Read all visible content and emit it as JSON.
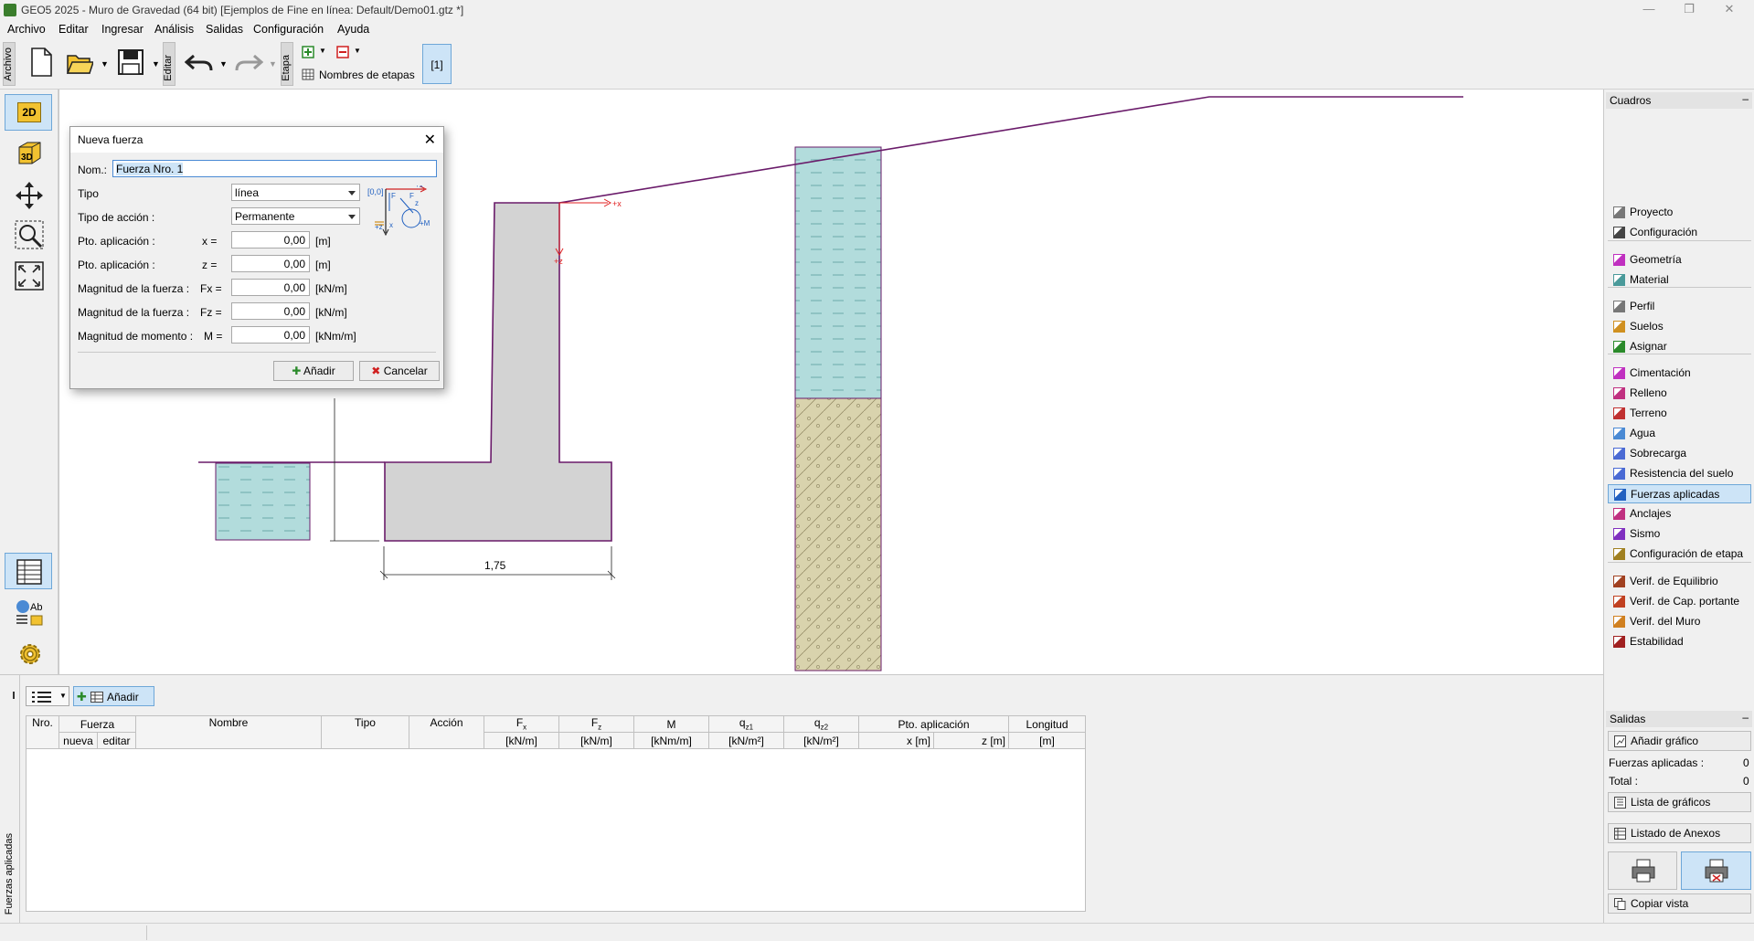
{
  "window": {
    "title": "GEO5 2025 - Muro de Gravedad (64 bit) [Ejemplos de Fine en línea: Default/Demo01.gtz *]"
  },
  "menu": [
    "Archivo",
    "Editar",
    "Ingresar",
    "Análisis",
    "Salidas",
    "Configuración",
    "Ayuda"
  ],
  "toolbar": {
    "archivo_tab": "Archivo",
    "editar_tab": "Editar",
    "etapa_tab": "Etapa",
    "stage_names_label": "Nombres de etapas",
    "stage_button": "[1]"
  },
  "left_tools": {
    "view_2d": "2D",
    "view_3d": "3D",
    "ab_label": "Ab"
  },
  "canvas": {
    "dimension_label": "1,75",
    "axis_x": "+x",
    "axis_z": "+z"
  },
  "dialog": {
    "title": "Nueva fuerza",
    "name_label": "Nom.:",
    "name_value": "Fuerza Nro. 1",
    "tipo_label": "Tipo",
    "tipo_value": "línea",
    "accion_label": "Tipo de acción :",
    "accion_value": "Permanente",
    "pto_x_label": "Pto. aplicación :",
    "pto_x_var": "x  =",
    "pto_x_value": "0,00",
    "pto_x_unit": "[m]",
    "pto_z_label": "Pto. aplicación :",
    "pto_z_var": "z  =",
    "pto_z_value": "0,00",
    "pto_z_unit": "[m]",
    "fx_label": "Magnitud de la fuerza :",
    "fx_var": "Fx =",
    "fx_value": "0,00",
    "fx_unit": "[kN/m]",
    "fz_label": "Magnitud de la fuerza :",
    "fz_var": "Fz =",
    "fz_value": "0,00",
    "fz_unit": "[kN/m]",
    "m_label": "Magnitud de momento :",
    "m_var": "M =",
    "m_value": "0,00",
    "m_unit": "[kNm/m]",
    "diagram_origin": "[0,0]",
    "diagram_x": "+x",
    "diagram_z": "+z",
    "diagram_m": "+M",
    "diagram_f": "F",
    "diagram_fx": "x",
    "diagram_fz": "z",
    "add_button": "Añadir",
    "cancel_button": "Cancelar"
  },
  "right_panel": {
    "cuadros_header": "Cuadros",
    "items": [
      {
        "label": "Proyecto",
        "icon": "project-icon"
      },
      {
        "label": "Configuración",
        "icon": "gear-icon"
      },
      {
        "label": "Geometría",
        "icon": "geometry-icon"
      },
      {
        "label": "Material",
        "icon": "material-icon"
      },
      {
        "label": "Perfil",
        "icon": "profile-icon"
      },
      {
        "label": "Suelos",
        "icon": "soils-icon"
      },
      {
        "label": "Asignar",
        "icon": "assign-icon"
      },
      {
        "label": "Cimentación",
        "icon": "foundation-icon"
      },
      {
        "label": "Relleno",
        "icon": "backfill-icon"
      },
      {
        "label": "Terreno",
        "icon": "terrain-icon"
      },
      {
        "label": "Agua",
        "icon": "water-icon"
      },
      {
        "label": "Sobrecarga",
        "icon": "surcharge-icon"
      },
      {
        "label": "Resistencia del suelo",
        "icon": "resistance-icon"
      },
      {
        "label": "Fuerzas aplicadas",
        "icon": "applied-forces-icon"
      },
      {
        "label": "Anclajes",
        "icon": "anchors-icon"
      },
      {
        "label": "Sismo",
        "icon": "earthquake-icon"
      },
      {
        "label": "Configuración de etapa",
        "icon": "stage-settings-icon"
      },
      {
        "label": "Verif. de Equilibrio",
        "icon": "equilibrium-icon"
      },
      {
        "label": "Verif. de Cap. portante",
        "icon": "bearing-icon"
      },
      {
        "label": "Verif. del Muro",
        "icon": "wall-check-icon"
      },
      {
        "label": "Estabilidad",
        "icon": "stability-icon"
      }
    ],
    "salidas_header": "Salidas",
    "add_graphic": "Añadir gráfico",
    "forces_label": "Fuerzas aplicadas :",
    "forces_count": "0",
    "total_label": "Total :",
    "total_count": "0",
    "graphic_list": "Lista de gráficos",
    "annex_list": "Listado de Anexos",
    "copy_view": "Copiar vista"
  },
  "bottom": {
    "tab_label": "Fuerzas aplicadas",
    "add_button": "Añadir",
    "headers": {
      "nro": "Nro.",
      "fuerza": "Fuerza",
      "nueva": "nueva",
      "editar": "editar",
      "nombre": "Nombre",
      "tipo": "Tipo",
      "accion": "Acción",
      "fx": "F",
      "fx_sub": "x",
      "fx_unit": "[kN/m]",
      "fz": "F",
      "fz_sub": "z",
      "fz_unit": "[kN/m]",
      "m": "M",
      "m_unit": "[kNm/m]",
      "qx1": "q",
      "qx1_sub": "z1",
      "qx1_unit": "[kN/m²]",
      "qx2": "q",
      "qx2_sub": "z2",
      "qx2_unit": "[kN/m²]",
      "pto": "Pto. aplicación",
      "pto_x": "x [m]",
      "pto_z": "z [m]",
      "longitud": "Longitud",
      "longitud_unit": "[m]"
    }
  },
  "colors": {
    "accent": "#6ea7d8",
    "highlight": "#cde4f7",
    "wall": "#d3d3d3",
    "water": "#b2dcdc",
    "soil": "#d9d3ad",
    "terrain_line": "#6a1b6a",
    "force_red": "#e02020"
  }
}
